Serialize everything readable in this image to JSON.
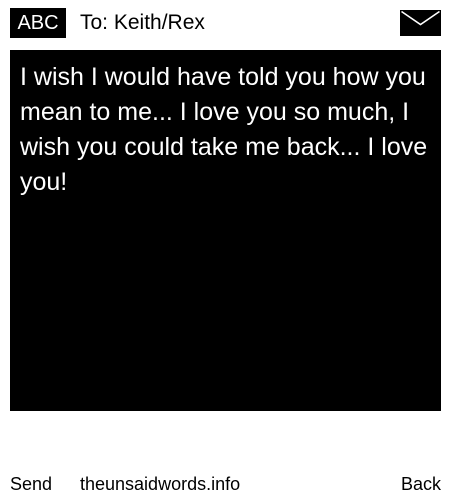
{
  "header": {
    "mode_badge": "ABC",
    "to_label": "To: Keith/Rex",
    "envelope_icon": "envelope-icon"
  },
  "message": {
    "body": "I wish I would have told you how you mean to me... I love you so much, I wish you could take me back... I love you!"
  },
  "footer": {
    "send_label": "Send",
    "site_credit": "theunsaidwords.info",
    "back_label": "Back"
  },
  "colors": {
    "background": "#ffffff",
    "message_background": "#000000",
    "message_text": "#ffffff",
    "text": "#000000"
  }
}
